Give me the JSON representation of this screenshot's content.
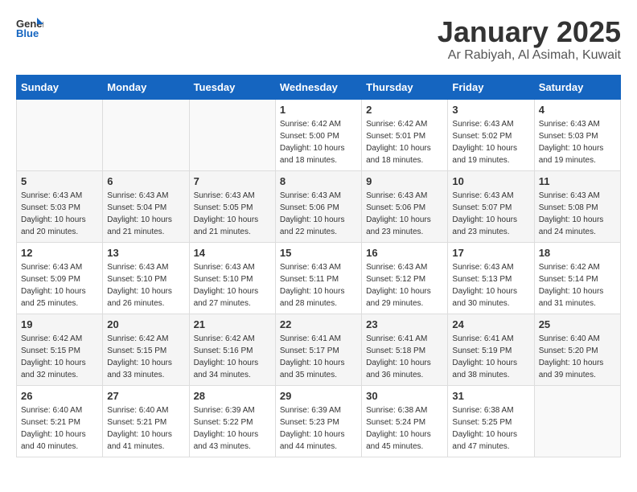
{
  "logo": {
    "general": "General",
    "blue": "Blue"
  },
  "title": "January 2025",
  "subtitle": "Ar Rabiyah, Al Asimah, Kuwait",
  "days_of_week": [
    "Sunday",
    "Monday",
    "Tuesday",
    "Wednesday",
    "Thursday",
    "Friday",
    "Saturday"
  ],
  "weeks": [
    [
      {
        "day": "",
        "info": ""
      },
      {
        "day": "",
        "info": ""
      },
      {
        "day": "",
        "info": ""
      },
      {
        "day": "1",
        "info": "Sunrise: 6:42 AM\nSunset: 5:00 PM\nDaylight: 10 hours\nand 18 minutes."
      },
      {
        "day": "2",
        "info": "Sunrise: 6:42 AM\nSunset: 5:01 PM\nDaylight: 10 hours\nand 18 minutes."
      },
      {
        "day": "3",
        "info": "Sunrise: 6:43 AM\nSunset: 5:02 PM\nDaylight: 10 hours\nand 19 minutes."
      },
      {
        "day": "4",
        "info": "Sunrise: 6:43 AM\nSunset: 5:03 PM\nDaylight: 10 hours\nand 19 minutes."
      }
    ],
    [
      {
        "day": "5",
        "info": "Sunrise: 6:43 AM\nSunset: 5:03 PM\nDaylight: 10 hours\nand 20 minutes."
      },
      {
        "day": "6",
        "info": "Sunrise: 6:43 AM\nSunset: 5:04 PM\nDaylight: 10 hours\nand 21 minutes."
      },
      {
        "day": "7",
        "info": "Sunrise: 6:43 AM\nSunset: 5:05 PM\nDaylight: 10 hours\nand 21 minutes."
      },
      {
        "day": "8",
        "info": "Sunrise: 6:43 AM\nSunset: 5:06 PM\nDaylight: 10 hours\nand 22 minutes."
      },
      {
        "day": "9",
        "info": "Sunrise: 6:43 AM\nSunset: 5:06 PM\nDaylight: 10 hours\nand 23 minutes."
      },
      {
        "day": "10",
        "info": "Sunrise: 6:43 AM\nSunset: 5:07 PM\nDaylight: 10 hours\nand 23 minutes."
      },
      {
        "day": "11",
        "info": "Sunrise: 6:43 AM\nSunset: 5:08 PM\nDaylight: 10 hours\nand 24 minutes."
      }
    ],
    [
      {
        "day": "12",
        "info": "Sunrise: 6:43 AM\nSunset: 5:09 PM\nDaylight: 10 hours\nand 25 minutes."
      },
      {
        "day": "13",
        "info": "Sunrise: 6:43 AM\nSunset: 5:10 PM\nDaylight: 10 hours\nand 26 minutes."
      },
      {
        "day": "14",
        "info": "Sunrise: 6:43 AM\nSunset: 5:10 PM\nDaylight: 10 hours\nand 27 minutes."
      },
      {
        "day": "15",
        "info": "Sunrise: 6:43 AM\nSunset: 5:11 PM\nDaylight: 10 hours\nand 28 minutes."
      },
      {
        "day": "16",
        "info": "Sunrise: 6:43 AM\nSunset: 5:12 PM\nDaylight: 10 hours\nand 29 minutes."
      },
      {
        "day": "17",
        "info": "Sunrise: 6:43 AM\nSunset: 5:13 PM\nDaylight: 10 hours\nand 30 minutes."
      },
      {
        "day": "18",
        "info": "Sunrise: 6:42 AM\nSunset: 5:14 PM\nDaylight: 10 hours\nand 31 minutes."
      }
    ],
    [
      {
        "day": "19",
        "info": "Sunrise: 6:42 AM\nSunset: 5:15 PM\nDaylight: 10 hours\nand 32 minutes."
      },
      {
        "day": "20",
        "info": "Sunrise: 6:42 AM\nSunset: 5:15 PM\nDaylight: 10 hours\nand 33 minutes."
      },
      {
        "day": "21",
        "info": "Sunrise: 6:42 AM\nSunset: 5:16 PM\nDaylight: 10 hours\nand 34 minutes."
      },
      {
        "day": "22",
        "info": "Sunrise: 6:41 AM\nSunset: 5:17 PM\nDaylight: 10 hours\nand 35 minutes."
      },
      {
        "day": "23",
        "info": "Sunrise: 6:41 AM\nSunset: 5:18 PM\nDaylight: 10 hours\nand 36 minutes."
      },
      {
        "day": "24",
        "info": "Sunrise: 6:41 AM\nSunset: 5:19 PM\nDaylight: 10 hours\nand 38 minutes."
      },
      {
        "day": "25",
        "info": "Sunrise: 6:40 AM\nSunset: 5:20 PM\nDaylight: 10 hours\nand 39 minutes."
      }
    ],
    [
      {
        "day": "26",
        "info": "Sunrise: 6:40 AM\nSunset: 5:21 PM\nDaylight: 10 hours\nand 40 minutes."
      },
      {
        "day": "27",
        "info": "Sunrise: 6:40 AM\nSunset: 5:21 PM\nDaylight: 10 hours\nand 41 minutes."
      },
      {
        "day": "28",
        "info": "Sunrise: 6:39 AM\nSunset: 5:22 PM\nDaylight: 10 hours\nand 43 minutes."
      },
      {
        "day": "29",
        "info": "Sunrise: 6:39 AM\nSunset: 5:23 PM\nDaylight: 10 hours\nand 44 minutes."
      },
      {
        "day": "30",
        "info": "Sunrise: 6:38 AM\nSunset: 5:24 PM\nDaylight: 10 hours\nand 45 minutes."
      },
      {
        "day": "31",
        "info": "Sunrise: 6:38 AM\nSunset: 5:25 PM\nDaylight: 10 hours\nand 47 minutes."
      },
      {
        "day": "",
        "info": ""
      }
    ]
  ]
}
